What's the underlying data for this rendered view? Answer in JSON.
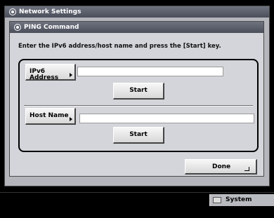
{
  "window": {
    "title": "Network Settings"
  },
  "panel": {
    "title": "PING Command",
    "instruction": "Enter the IPv6 address/host name and press the [Start] key."
  },
  "ipv6": {
    "button_label": "IPv6 Address",
    "value": "",
    "start_label": "Start"
  },
  "host": {
    "button_label": "Host Name",
    "value": "",
    "start_label": "Start"
  },
  "done_label": "Done",
  "status_bar": {
    "system_monitor_label": "System Monitor"
  },
  "icons": {
    "window": "network-icon",
    "panel": "network-icon",
    "enter": "enter-icon",
    "monitor": "monitor-icon"
  }
}
